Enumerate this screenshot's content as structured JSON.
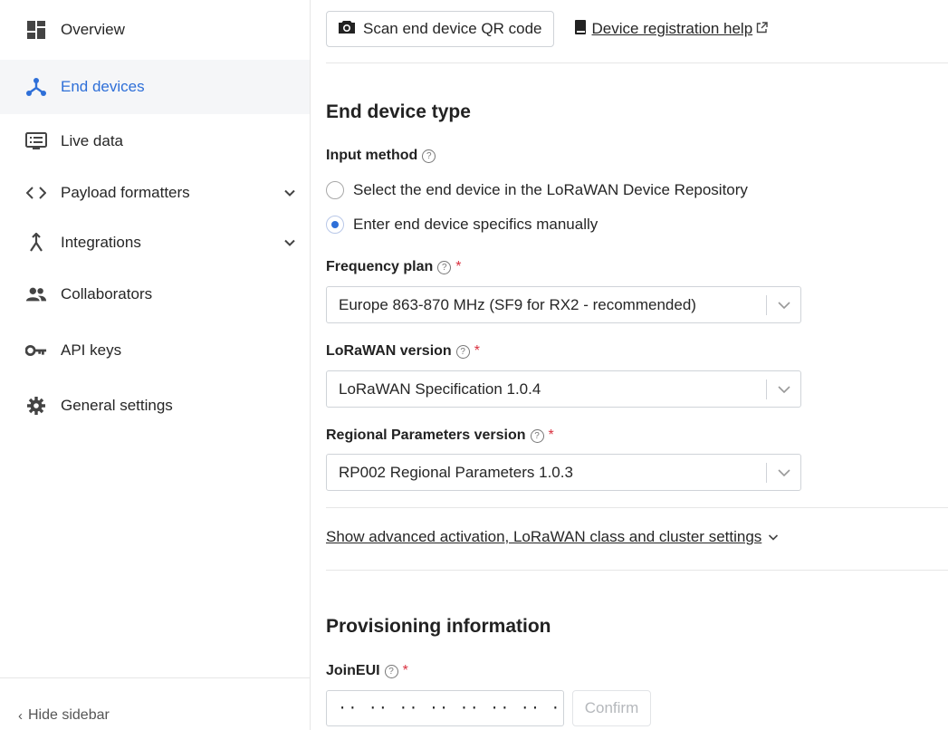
{
  "sidebar": {
    "items": [
      {
        "label": "Overview",
        "icon": "overview-icon"
      },
      {
        "label": "End devices",
        "icon": "end-devices-icon",
        "active": true
      },
      {
        "label": "Live data",
        "icon": "live-data-icon"
      },
      {
        "label": "Payload formatters",
        "icon": "code-icon",
        "expandable": true
      },
      {
        "label": "Integrations",
        "icon": "integrations-icon",
        "expandable": true
      },
      {
        "label": "Collaborators",
        "icon": "collaborators-icon"
      },
      {
        "label": "API keys",
        "icon": "key-icon"
      },
      {
        "label": "General settings",
        "icon": "gear-icon"
      }
    ],
    "hide_label": "Hide sidebar"
  },
  "toolbar": {
    "scan_label": "Scan end device QR code",
    "help_label": "Device registration help"
  },
  "device_type": {
    "heading": "End device type",
    "input_method_label": "Input method",
    "options": [
      {
        "label": "Select the end device in the LoRaWAN Device Repository",
        "selected": false
      },
      {
        "label": "Enter end device specifics manually",
        "selected": true
      }
    ],
    "frequency_plan": {
      "label": "Frequency plan",
      "value": "Europe 863-870 MHz (SF9 for RX2 - recommended)"
    },
    "lorawan_version": {
      "label": "LoRaWAN version",
      "value": "LoRaWAN Specification 1.0.4"
    },
    "regional_params": {
      "label": "Regional Parameters version",
      "value": "RP002 Regional Parameters 1.0.3"
    },
    "advanced_label": "Show advanced activation, LoRaWAN class and cluster settings"
  },
  "provisioning": {
    "heading": "Provisioning information",
    "joineui_label": "JoinEUI",
    "joineui_value": "·· ·· ·· ·· ·· ·· ·· ··",
    "confirm_label": "Confirm"
  },
  "required_mark": "*",
  "help_mark": "?",
  "colors": {
    "accent": "#2e6fd8",
    "required": "#d9303f",
    "active_bg": "#f5f6f8"
  }
}
